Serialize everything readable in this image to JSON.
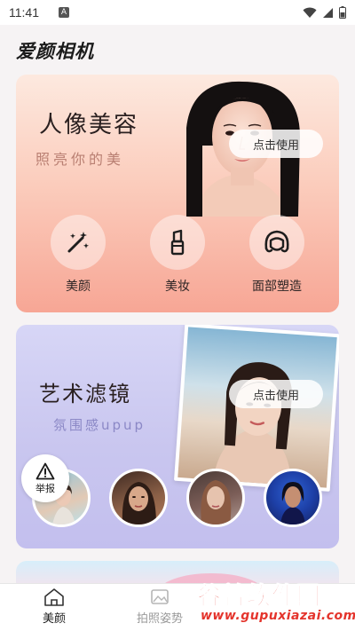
{
  "status_bar": {
    "time": "11:41",
    "a_badge": "A"
  },
  "app": {
    "title": "爱颜相机"
  },
  "portrait_card": {
    "title": "人像美容",
    "subtitle": "照亮你的美",
    "button_label": "点击使用",
    "features": [
      {
        "label": "美颜",
        "icon": "magic-wand-icon"
      },
      {
        "label": "美妆",
        "icon": "lipstick-icon"
      },
      {
        "label": "面部塑造",
        "icon": "face-shape-icon"
      }
    ]
  },
  "filter_card": {
    "title": "艺术滤镜",
    "subtitle": "氛围感upup",
    "button_label": "点击使用",
    "report_label": "举报"
  },
  "bottom_nav": {
    "items": [
      {
        "label": "美颜",
        "icon": "home-icon",
        "active": true
      },
      {
        "label": "拍照姿势",
        "icon": "image-icon",
        "active": false
      }
    ]
  },
  "watermark": {
    "name": "谷普软件园",
    "url": "www.gupuxiazai.com"
  },
  "colors": {
    "portrait_card_top": "#fde9df",
    "portrait_card_bottom": "#f7a695",
    "filter_card": "#c9c6ef",
    "watermark_red": "#e4342c"
  }
}
